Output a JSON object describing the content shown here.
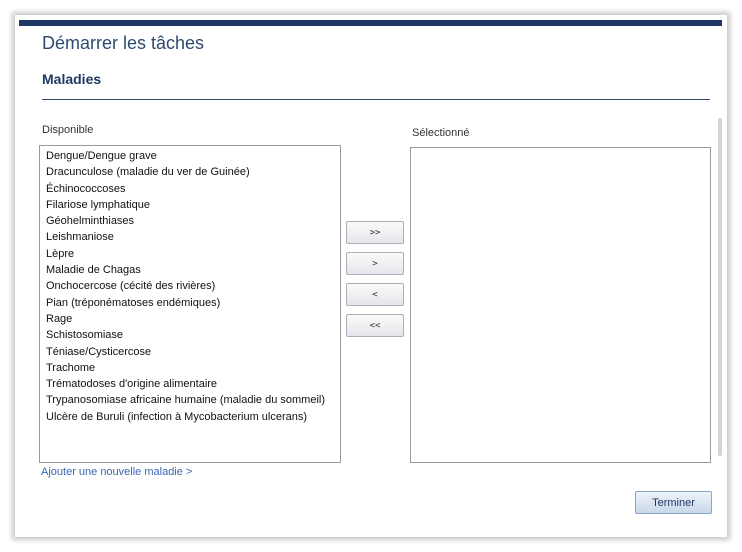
{
  "page": {
    "title": "Démarrer les tâches",
    "section_title": "Maladies"
  },
  "available": {
    "label": "Disponible",
    "items": [
      "Dengue/Dengue grave",
      "Dracunculose (maladie du ver de Guinée)",
      "Échinococcoses",
      "Filariose lymphatique",
      "Géohelminthiases",
      "Leishmaniose",
      "Lèpre",
      "Maladie de Chagas",
      "Onchocercose (cécité des rivières)",
      "Pian (tréponématoses endémiques)",
      "Rage",
      "Schistosomiase",
      "Téniase/Cysticercose",
      "Trachome",
      "Trématodoses d'origine alimentaire",
      "Trypanosomiase africaine humaine (maladie du sommeil)",
      "Ulcère de Buruli (infection à Mycobacterium ulcerans)"
    ]
  },
  "selected": {
    "label": "Sélectionné",
    "items": []
  },
  "transfer_buttons": {
    "move_all_right": ">>",
    "move_right": ">",
    "move_left": "<",
    "move_all_left": "<<"
  },
  "add_link": "Ajouter une nouvelle maladie >",
  "finish_button": "Terminer",
  "colors": {
    "header_bar": "#1f3864",
    "link": "#3a67b5",
    "title": "#2e4a70"
  }
}
